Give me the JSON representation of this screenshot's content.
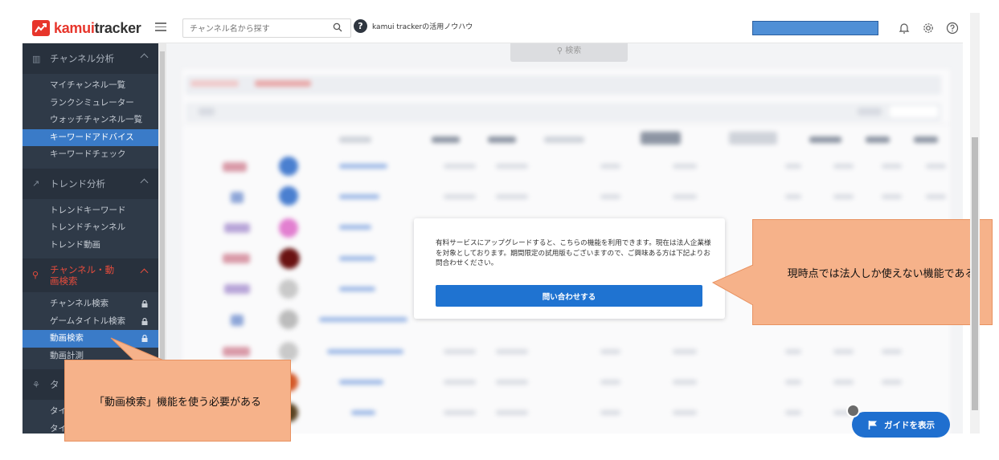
{
  "header": {
    "logo_text_brand": "kamui",
    "logo_text_rest": "tracker",
    "search_placeholder": "チャンネル名から探す",
    "help_text": "kamui trackerの活用ノウハウ",
    "help_badge": "?"
  },
  "sidebar": {
    "sections": [
      {
        "label": "チャンネル分析",
        "items": [
          {
            "label": "マイチャンネル一覧"
          },
          {
            "label": "ランクシミュレーター"
          },
          {
            "label": "ウォッチチャンネル一覧"
          },
          {
            "label": "キーワードアドバイス",
            "active": true
          },
          {
            "label": "キーワードチェック"
          }
        ]
      },
      {
        "label": "トレンド分析",
        "items": [
          {
            "label": "トレンドキーワード"
          },
          {
            "label": "トレンドチャンネル"
          },
          {
            "label": "トレンド動画"
          }
        ]
      },
      {
        "label": "チャンネル・動画検索",
        "items": [
          {
            "label": "チャンネル検索",
            "locked": true
          },
          {
            "label": "ゲームタイトル検索",
            "locked": true
          },
          {
            "label": "動画検索",
            "locked": true,
            "active": true
          },
          {
            "label": "動画計測",
            "locked": true
          }
        ]
      },
      {
        "label": "タ",
        "items": [
          {
            "label": "タイ"
          },
          {
            "label": "タイ"
          }
        ]
      }
    ]
  },
  "main": {
    "search_button": "検索"
  },
  "modal": {
    "message": "有料サービスにアップグレードすると、こちらの機能を利用できます。現在は法人企業様を対象としております。期間限定の試用版もございますので、ご興味ある方は下記よりお問合わせください。",
    "contact_button": "問い合わせする"
  },
  "callouts": {
    "right": "現時点では法人しか使えない機能である",
    "left": "「動画検索」機能を使う必要がある"
  },
  "guide_button": "ガイドを表示",
  "colors": {
    "brand_red": "#e7352b",
    "sidebar_bg": "#2f3a48",
    "active_blue": "#3a7bc8",
    "button_blue": "#1f73d1",
    "callout_orange": "#f6b28a"
  }
}
